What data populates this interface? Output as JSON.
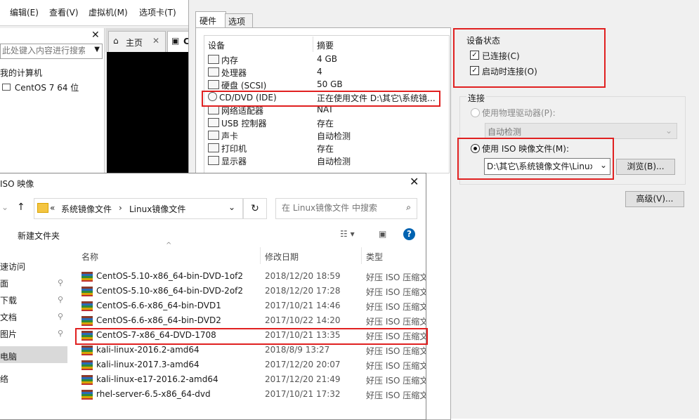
{
  "vm_window": {
    "menu": [
      "编辑(E)",
      "查看(V)",
      "虚拟机(M)",
      "选项卡(T)"
    ],
    "library_search_placeholder": "此处键入内容进行搜索",
    "tree_root": "我的计算机",
    "tree_vm": "CentOS 7 64 位",
    "tab_home": "主页",
    "tab_vm": "C"
  },
  "settings": {
    "tabs": [
      "硬件",
      "选项"
    ],
    "device_header": "设备",
    "summary_header": "摘要",
    "devices": [
      {
        "icon": "memory-icon",
        "name": "内存",
        "summary": "4 GB"
      },
      {
        "icon": "cpu-icon",
        "name": "处理器",
        "summary": "4"
      },
      {
        "icon": "disk-icon",
        "name": "硬盘 (SCSI)",
        "summary": "50 GB"
      },
      {
        "icon": "cd-icon",
        "name": "CD/DVD (IDE)",
        "summary": "正在使用文件 D:\\其它\\系统镜..."
      },
      {
        "icon": "network-icon",
        "name": "网络适配器",
        "summary": "NAT"
      },
      {
        "icon": "usb-icon",
        "name": "USB 控制器",
        "summary": "存在"
      },
      {
        "icon": "sound-icon",
        "name": "声卡",
        "summary": "自动检测"
      },
      {
        "icon": "printer-icon",
        "name": "打印机",
        "summary": "存在"
      },
      {
        "icon": "display-icon",
        "name": "显示器",
        "summary": "自动检测"
      }
    ],
    "device_status_label": "设备状态",
    "connected_label": "已连接(C)",
    "connect_on_power_label": "启动时连接(O)",
    "connection_label": "连接",
    "physical_drive_label": "使用物理驱动器(P):",
    "physical_drive_value": "自动检测",
    "iso_label": "使用 ISO 映像文件(M):",
    "iso_value": "D:\\其它\\系统镜像文件\\Linux",
    "browse_button": "浏览(B)...",
    "advanced_button": "高级(V)..."
  },
  "file_dialog": {
    "title": "ISO 映像",
    "breadcrumb": [
      "«",
      "系统镜像文件",
      "›",
      "Linux镜像文件"
    ],
    "search_placeholder": "在 Linux镜像文件 中搜索",
    "new_folder": "新建文件夹",
    "columns": [
      "名称",
      "修改日期",
      "类型"
    ],
    "nav_items": [
      "速访问",
      "面",
      "下载",
      "文档",
      "图片",
      "电脑",
      "络"
    ],
    "files": [
      {
        "name": "CentOS-5.10-x86_64-bin-DVD-1of2",
        "date": "2018/12/20 18:59",
        "type": "好压 ISO 压缩文"
      },
      {
        "name": "CentOS-5.10-x86_64-bin-DVD-2of2",
        "date": "2018/12/20 17:28",
        "type": "好压 ISO 压缩文"
      },
      {
        "name": "CentOS-6.6-x86_64-bin-DVD1",
        "date": "2017/10/21 14:46",
        "type": "好压 ISO 压缩文"
      },
      {
        "name": "CentOS-6.6-x86_64-bin-DVD2",
        "date": "2017/10/22 14:20",
        "type": "好压 ISO 压缩文"
      },
      {
        "name": "CentOS-7-x86_64-DVD-1708",
        "date": "2017/10/21 13:35",
        "type": "好压 ISO 压缩文"
      },
      {
        "name": "kali-linux-2016.2-amd64",
        "date": "2018/8/9 13:27",
        "type": "好压 ISO 压缩文"
      },
      {
        "name": "kali-linux-2017.3-amd64",
        "date": "2017/12/20 20:07",
        "type": "好压 ISO 压缩文"
      },
      {
        "name": "kali-linux-e17-2016.2-amd64",
        "date": "2017/12/20 21:49",
        "type": "好压 ISO 压缩文"
      },
      {
        "name": "rhel-server-6.5-x86_64-dvd",
        "date": "2017/10/21 17:32",
        "type": "好压 ISO 压缩文"
      }
    ]
  },
  "colors": {
    "annotation": "#e02020",
    "accent": "#0063b1"
  }
}
